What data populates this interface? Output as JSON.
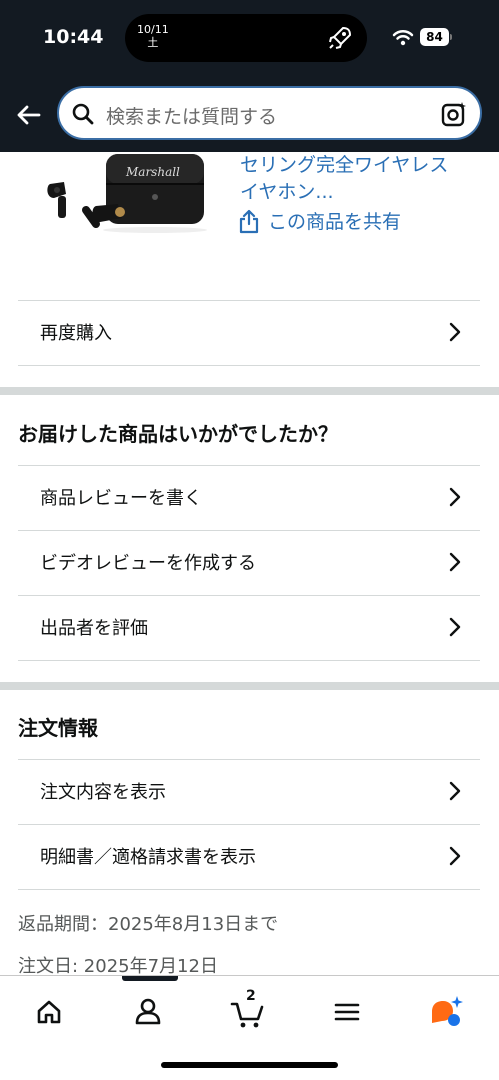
{
  "status_bar": {
    "time": "10:44",
    "date_line1": "10/11",
    "date_line2": "土",
    "battery": "84"
  },
  "search": {
    "placeholder": "検索または質問する"
  },
  "product": {
    "title_line1": "セリング完全ワイヤレス",
    "title_line2": "イヤホン...",
    "share_label": "この商品を共有"
  },
  "actions": {
    "buy_again": "再度購入"
  },
  "feedback": {
    "title": "お届けした商品はいかがでしたか？",
    "items": [
      "商品レビューを書く",
      "ビデオレビューを作成する",
      "出品者を評価"
    ]
  },
  "order_info": {
    "title": "注文情報",
    "items": [
      "注文内容を表示",
      "明細書／適格請求書を表示"
    ],
    "return_period": "返品期間：2025年8月13日まで",
    "order_date": "注文日: 2025年7月12日"
  },
  "tabbar": {
    "cart_count": "2"
  },
  "colors": {
    "header_bg": "#131a22",
    "link": "#2a6fb5",
    "accent": "#ff6a13"
  },
  "icons": [
    "back-arrow-icon",
    "search-icon",
    "camera-icon",
    "share-icon",
    "chevron-right-icon",
    "home-icon",
    "account-icon",
    "cart-icon",
    "menu-icon",
    "rufus-icon"
  ]
}
